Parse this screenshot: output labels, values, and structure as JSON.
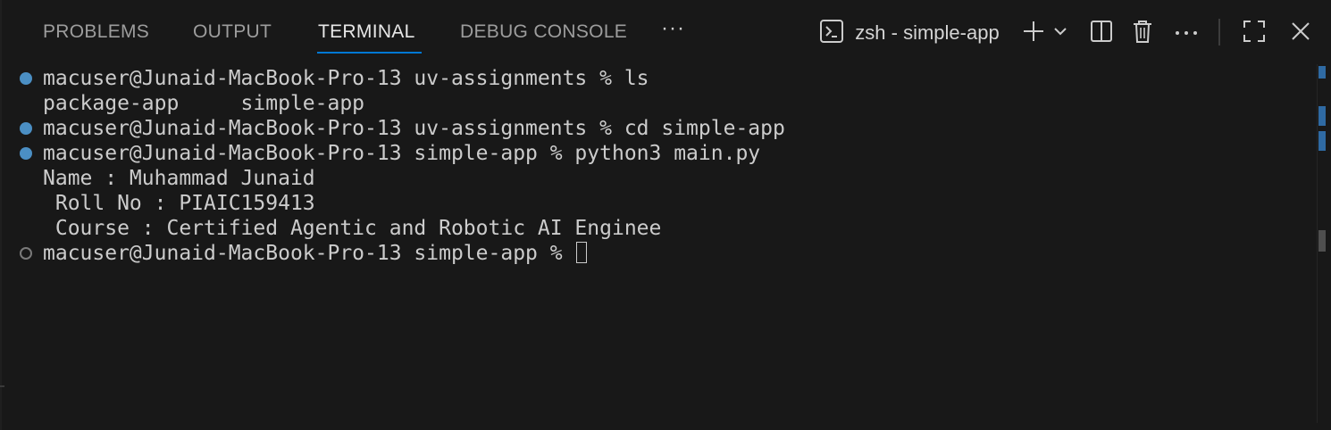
{
  "tabs": [
    {
      "label": "PROBLEMS",
      "active": false
    },
    {
      "label": "OUTPUT",
      "active": false
    },
    {
      "label": "TERMINAL",
      "active": true
    },
    {
      "label": "DEBUG CONSOLE",
      "active": false
    }
  ],
  "more_tabs_label": "···",
  "toolbar": {
    "terminal_name": "zsh - simple-app",
    "terminal_icon": "terminal-icon",
    "icons": [
      "plus-icon",
      "chevron-down-icon",
      "split-editor-icon",
      "trash-icon",
      "ellipsis-icon",
      "maximize-icon",
      "close-icon"
    ]
  },
  "colors": {
    "background": "#181818",
    "accent": "#0078d4",
    "success_decoration": "#4b8fc4",
    "text": "#cccccc"
  },
  "terminal": {
    "lines": [
      {
        "text": "macuser@Junaid-MacBook-Pro-13 uv-assignments % ls",
        "decoration": "success"
      },
      {
        "text": "package-app     simple-app",
        "decoration": "none"
      },
      {
        "text": "macuser@Junaid-MacBook-Pro-13 uv-assignments % cd simple-app",
        "decoration": "success"
      },
      {
        "text": "macuser@Junaid-MacBook-Pro-13 simple-app % python3 main.py",
        "decoration": "success"
      },
      {
        "text": "Name : Muhammad Junaid",
        "decoration": "none"
      },
      {
        "text": " Roll No : PIAIC159413",
        "decoration": "none"
      },
      {
        "text": " Course : Certified Agentic and Robotic AI Enginee",
        "decoration": "none"
      },
      {
        "text": "macuser@Junaid-MacBook-Pro-13 simple-app % ",
        "decoration": "empty",
        "cursor": true
      }
    ]
  }
}
